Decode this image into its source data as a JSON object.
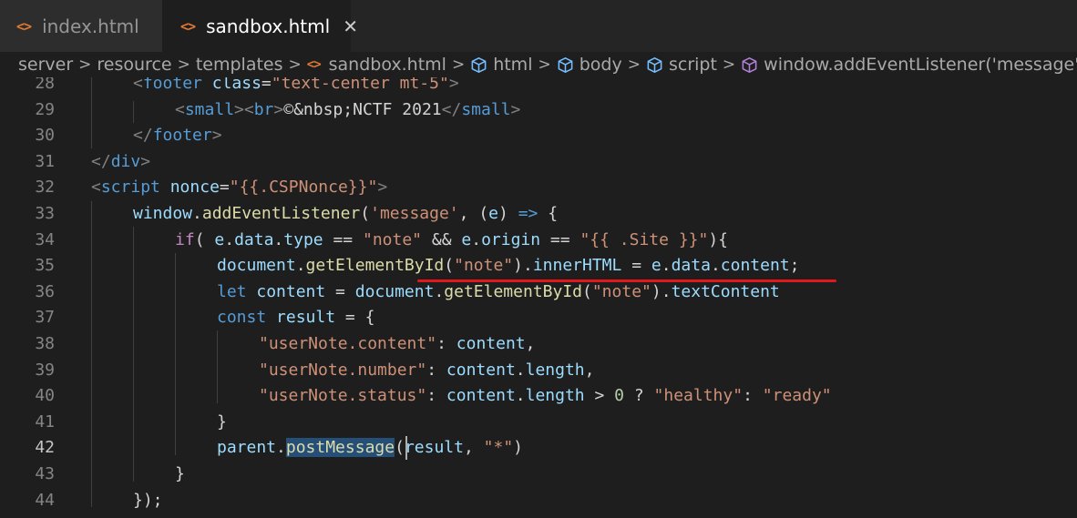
{
  "tabs": [
    {
      "label": "index.html",
      "icon": "html-code-icon",
      "active": false
    },
    {
      "label": "sandbox.html",
      "icon": "html-code-icon",
      "active": true
    }
  ],
  "tab_icon_glyph": "<>",
  "close_glyph": "✕",
  "breadcrumb": {
    "separator": ">",
    "items": [
      {
        "label": "server"
      },
      {
        "label": "resource"
      },
      {
        "label": "templates"
      },
      {
        "label": "sandbox.html"
      },
      {
        "label": "html"
      },
      {
        "label": "body"
      },
      {
        "label": "script"
      },
      {
        "label": "window.addEventListener('message') callback"
      }
    ]
  },
  "editor": {
    "line_numbers": [
      "28",
      "29",
      "30",
      "31",
      "32",
      "33",
      "34",
      "35",
      "36",
      "37",
      "38",
      "39",
      "40",
      "41",
      "42",
      "43",
      "44"
    ],
    "current_line": "42",
    "lines": [
      [
        [
          "t-punc",
          "<"
        ],
        [
          "t-tag",
          "footer"
        ],
        [
          "t-plain",
          " "
        ],
        [
          "t-attr",
          "class"
        ],
        [
          "t-plain",
          "="
        ],
        [
          "t-str",
          "\"text-center mt-5\""
        ],
        [
          "t-punc",
          ">"
        ]
      ],
      [
        [
          "t-punc",
          "<"
        ],
        [
          "t-tag",
          "small"
        ],
        [
          "t-punc",
          "><"
        ],
        [
          "t-tag",
          "br"
        ],
        [
          "t-punc",
          ">"
        ],
        [
          "t-plain",
          "©&nbsp;NCTF 2021"
        ],
        [
          "t-punc",
          "</"
        ],
        [
          "t-tag",
          "small"
        ],
        [
          "t-punc",
          ">"
        ]
      ],
      [
        [
          "t-punc",
          "</"
        ],
        [
          "t-tag",
          "footer"
        ],
        [
          "t-punc",
          ">"
        ]
      ],
      [
        [
          "t-punc",
          "</"
        ],
        [
          "t-tag",
          "div"
        ],
        [
          "t-punc",
          ">"
        ]
      ],
      [
        [
          "t-punc",
          "<"
        ],
        [
          "t-tag",
          "script"
        ],
        [
          "t-plain",
          " "
        ],
        [
          "t-attr",
          "nonce"
        ],
        [
          "t-plain",
          "="
        ],
        [
          "t-str",
          "\"{{.CSPNonce}}\""
        ],
        [
          "t-punc",
          ">"
        ]
      ],
      [
        [
          "t-var",
          "window"
        ],
        [
          "t-plain",
          "."
        ],
        [
          "t-fn",
          "addEventListener"
        ],
        [
          "t-plain",
          "("
        ],
        [
          "t-str",
          "'message'"
        ],
        [
          "t-plain",
          ", ("
        ],
        [
          "t-var",
          "e"
        ],
        [
          "t-plain",
          ") "
        ],
        [
          "t-kw",
          "=>"
        ],
        [
          "t-plain",
          " {"
        ]
      ],
      [
        [
          "t-ctrl",
          "if"
        ],
        [
          "t-plain",
          "( "
        ],
        [
          "t-var",
          "e"
        ],
        [
          "t-plain",
          "."
        ],
        [
          "t-var",
          "data"
        ],
        [
          "t-plain",
          "."
        ],
        [
          "t-var",
          "type"
        ],
        [
          "t-plain",
          " == "
        ],
        [
          "t-str",
          "\"note\""
        ],
        [
          "t-plain",
          " && "
        ],
        [
          "t-var",
          "e"
        ],
        [
          "t-plain",
          "."
        ],
        [
          "t-var",
          "origin"
        ],
        [
          "t-plain",
          " == "
        ],
        [
          "t-str",
          "\"{{ .Site }}\""
        ],
        [
          "t-plain",
          "){"
        ]
      ],
      [
        [
          "t-var",
          "document"
        ],
        [
          "t-plain",
          "."
        ],
        [
          "t-fn",
          "getElementById"
        ],
        [
          "t-plain",
          "("
        ],
        [
          "t-str",
          "\"note\""
        ],
        [
          "t-plain",
          ")."
        ],
        [
          "t-var",
          "innerHTML"
        ],
        [
          "t-plain",
          " = "
        ],
        [
          "t-var",
          "e"
        ],
        [
          "t-plain",
          "."
        ],
        [
          "t-var",
          "data"
        ],
        [
          "t-plain",
          "."
        ],
        [
          "t-var",
          "content"
        ],
        [
          "t-plain",
          ";"
        ]
      ],
      [
        [
          "t-kw",
          "let"
        ],
        [
          "t-plain",
          " "
        ],
        [
          "t-var",
          "content"
        ],
        [
          "t-plain",
          " = "
        ],
        [
          "t-var",
          "document"
        ],
        [
          "t-plain",
          "."
        ],
        [
          "t-fn",
          "getElementById"
        ],
        [
          "t-plain",
          "("
        ],
        [
          "t-str",
          "\"note\""
        ],
        [
          "t-plain",
          ")."
        ],
        [
          "t-var",
          "textContent"
        ]
      ],
      [
        [
          "t-kw",
          "const"
        ],
        [
          "t-plain",
          " "
        ],
        [
          "t-var",
          "result"
        ],
        [
          "t-plain",
          " = {"
        ]
      ],
      [
        [
          "t-str",
          "\"userNote.content\""
        ],
        [
          "t-plain",
          ": "
        ],
        [
          "t-var",
          "content"
        ],
        [
          "t-plain",
          ","
        ]
      ],
      [
        [
          "t-str",
          "\"userNote.number\""
        ],
        [
          "t-plain",
          ": "
        ],
        [
          "t-var",
          "content"
        ],
        [
          "t-plain",
          "."
        ],
        [
          "t-var",
          "length"
        ],
        [
          "t-plain",
          ","
        ]
      ],
      [
        [
          "t-str",
          "\"userNote.status\""
        ],
        [
          "t-plain",
          ": "
        ],
        [
          "t-var",
          "content"
        ],
        [
          "t-plain",
          "."
        ],
        [
          "t-var",
          "length"
        ],
        [
          "t-plain",
          " > "
        ],
        [
          "t-num",
          "0"
        ],
        [
          "t-plain",
          " ? "
        ],
        [
          "t-str",
          "\"healthy\""
        ],
        [
          "t-plain",
          ": "
        ],
        [
          "t-str",
          "\"ready\""
        ]
      ],
      [
        [
          "t-plain",
          "}"
        ]
      ],
      [
        [
          "t-var",
          "parent"
        ],
        [
          "t-plain",
          "."
        ],
        [
          "t-fn hl",
          "postMessage"
        ],
        [
          "t-plain",
          "("
        ],
        [
          "t-var",
          "result"
        ],
        [
          "t-plain",
          ", "
        ],
        [
          "t-str",
          "\"*\""
        ],
        [
          "t-plain",
          ")"
        ]
      ],
      [
        [
          "t-plain",
          "}"
        ]
      ],
      [
        [
          "t-plain",
          "});"
        ]
      ]
    ]
  },
  "colors": {
    "background": "#1e1e1e",
    "underline": "#e0181b",
    "html_icon": "#e37933",
    "symbol_cube_icon": "#75beff",
    "symbol_method_icon": "#b180d7"
  }
}
